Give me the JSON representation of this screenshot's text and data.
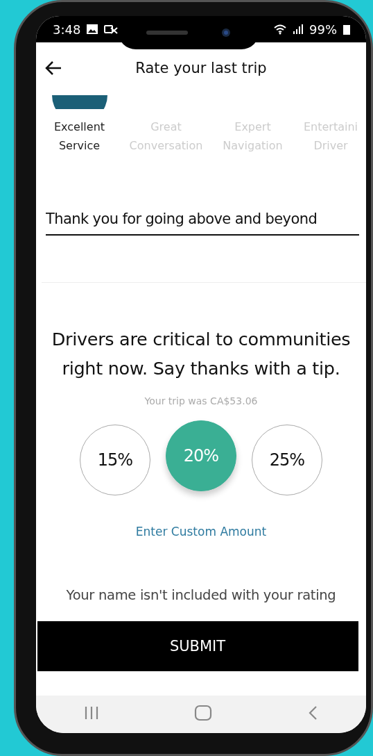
{
  "status_bar": {
    "time": "3:48",
    "battery": "99%"
  },
  "header": {
    "title": "Rate your last trip"
  },
  "compliments": [
    {
      "lines": [
        "Excellent",
        "Service"
      ],
      "selected": true
    },
    {
      "lines": [
        "Great",
        "Conversation"
      ],
      "selected": false
    },
    {
      "lines": [
        "Expert",
        "Navigation"
      ],
      "selected": false
    },
    {
      "lines": [
        "Entertaini",
        "Driver"
      ],
      "selected": false
    }
  ],
  "comment": {
    "value": "Thank you for going above and beyond"
  },
  "tip": {
    "headline": "Drivers are critical to communities right now. Say thanks with a tip.",
    "fare": "Your trip was CA$53.06",
    "options": [
      {
        "label": "15%",
        "selected": false
      },
      {
        "label": "20%",
        "selected": true
      },
      {
        "label": "25%",
        "selected": false
      }
    ],
    "custom_link": "Enter Custom Amount"
  },
  "notice": "Your name isn't included with your rating",
  "submit": "SUBMIT"
}
